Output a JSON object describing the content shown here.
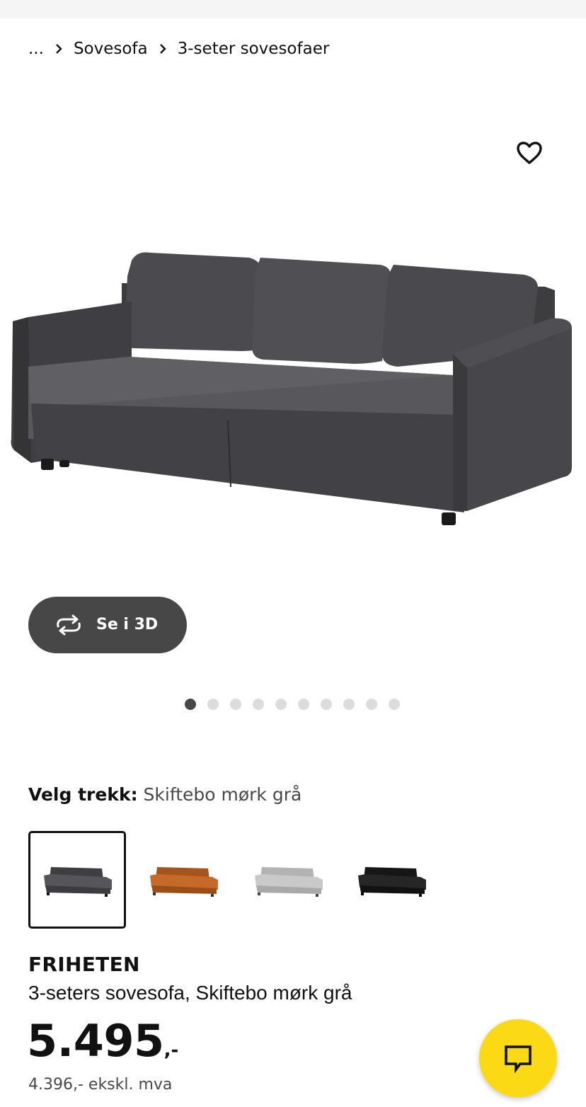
{
  "breadcrumb": {
    "items": [
      "...",
      "Sovesofa",
      "3-seter sovesofaer"
    ]
  },
  "gallery": {
    "view_3d_label": "Se i 3D",
    "total_images": 10,
    "active_index": 0
  },
  "variant": {
    "label": "Velg trekk:",
    "selected_value": "Skiftebo mørk grå",
    "swatches": [
      {
        "color": "#4a4a4d",
        "selected": true
      },
      {
        "color": "#c66a2b",
        "selected": false
      },
      {
        "color": "#c9c9c9",
        "selected": false
      },
      {
        "color": "#1f1f1f",
        "selected": false
      }
    ]
  },
  "product": {
    "name": "FRIHETEN",
    "description": "3-seters sovesofa, Skiftebo mørk grå",
    "price": "5.495",
    "price_suffix": ",-",
    "price_ex_vat": "4.396,- ekskl. mva"
  },
  "icons": {
    "favorite": "heart-outline-icon",
    "rotate": "rotate-3d-icon",
    "chat": "chat-bubble-icon",
    "chevron": "chevron-right-icon"
  },
  "colors": {
    "accent_yellow": "#fbd914",
    "button_dark": "#474747",
    "text_primary": "#111111",
    "text_secondary": "#484848"
  }
}
